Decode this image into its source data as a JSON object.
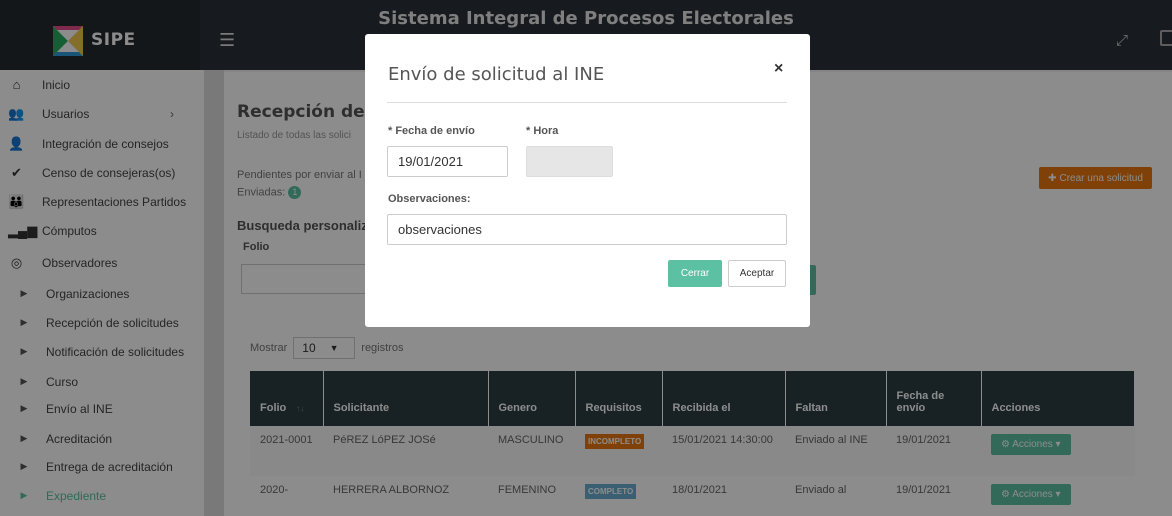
{
  "topbar": {
    "logo_text": "SIPE",
    "system_title": "Sistema Integral de Procesos Electorales",
    "menu_icon": "hamburger-icon",
    "fullscreen_icon": "expand-icon"
  },
  "sidebar": {
    "items": [
      {
        "label": "Inicio",
        "icon": "home-icon"
      },
      {
        "label": "Usuarios",
        "icon": "users-icon"
      },
      {
        "label": "Integración de consejos",
        "icon": "group-icon"
      },
      {
        "label": "Censo de consejeras(os)",
        "icon": "check-icon"
      },
      {
        "label": "Representaciones Partidos",
        "icon": "people-icon"
      },
      {
        "label": "Cómputos",
        "icon": "bar-chart-icon"
      },
      {
        "label": "Observadores",
        "icon": "eye-icon"
      }
    ],
    "subitems": [
      {
        "label": "Organizaciones"
      },
      {
        "label": "Recepción de solicitudes"
      },
      {
        "label": "Notificación de solicitudes"
      },
      {
        "label": "Curso"
      },
      {
        "label": "Envío al INE"
      },
      {
        "label": "Acreditación"
      },
      {
        "label": "Entrega de acreditación"
      },
      {
        "label": "Expediente"
      }
    ]
  },
  "main": {
    "title": "Recepción de sol",
    "subtitle": "Listado de todas las solici",
    "pending": "Pendientes por enviar al I",
    "sent_label": "Enviadas:",
    "sent_count": "1",
    "search_title": "Busqueda personaliz",
    "folio_label": "Folio",
    "create_button": "Crear una solicitud",
    "show_label": "Mostrar",
    "show_value": "10",
    "records_label": "registros"
  },
  "table": {
    "headers": [
      "Folio",
      "Solicitante",
      "Genero",
      "Requisitos",
      "Recibida el",
      "Faltan",
      "Fecha de envío",
      "Acciones"
    ],
    "rows": [
      {
        "folio": "2021-0001",
        "solicitante": "PéREZ LóPEZ JOSé",
        "genero": "MASCULINO",
        "requisitos": "INCOMPLETO",
        "recibida": "15/01/2021 14:30:00",
        "faltan": "Enviado al INE",
        "fecha_envio": "19/01/2021",
        "acciones": "Acciones"
      },
      {
        "folio": "2020-",
        "solicitante": "HERRERA ALBORNOZ",
        "genero": "FEMENINO",
        "requisitos": "COMPLETO",
        "recibida": "18/01/2021",
        "faltan": "Enviado al",
        "fecha_envio": "19/01/2021",
        "acciones": "Acciones"
      }
    ]
  },
  "modal": {
    "title": "Envío de solicitud al INE",
    "close": "×",
    "fecha_label": "* Fecha de envío",
    "hora_label": "* Hora",
    "fecha_value": "19/01/2021",
    "hora_value": "",
    "obs_label": "Observaciones:",
    "obs_placeholder": "observaciones",
    "cerrar": "Cerrar",
    "aceptar": "Aceptar"
  }
}
